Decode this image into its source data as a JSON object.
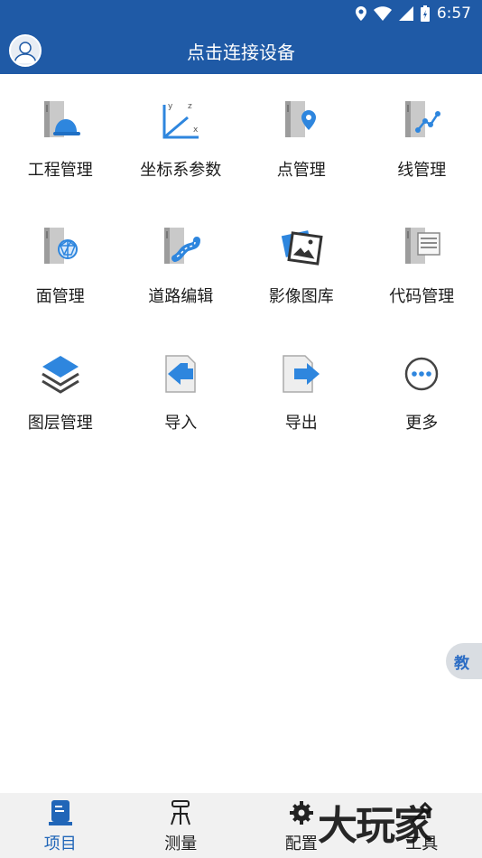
{
  "status_bar": {
    "time": "6:57",
    "bg_color": "#1f5aa6"
  },
  "header": {
    "title": "点击连接设备",
    "avatar_icon": "user-avatar-icon"
  },
  "grid": {
    "items": [
      {
        "label": "工程管理",
        "icon": "project-management-icon"
      },
      {
        "label": "坐标系参数",
        "icon": "coordinate-system-icon"
      },
      {
        "label": "点管理",
        "icon": "point-management-icon"
      },
      {
        "label": "线管理",
        "icon": "line-management-icon"
      },
      {
        "label": "面管理",
        "icon": "surface-management-icon"
      },
      {
        "label": "道路编辑",
        "icon": "road-edit-icon"
      },
      {
        "label": "影像图库",
        "icon": "image-library-icon"
      },
      {
        "label": "代码管理",
        "icon": "code-management-icon"
      },
      {
        "label": "图层管理",
        "icon": "layer-management-icon"
      },
      {
        "label": "导入",
        "icon": "import-icon"
      },
      {
        "label": "导出",
        "icon": "export-icon"
      },
      {
        "label": "更多",
        "icon": "more-icon"
      }
    ]
  },
  "side_tab": {
    "label": "教"
  },
  "bottom_nav": {
    "items": [
      {
        "label": "项目",
        "icon": "project-icon",
        "active": true
      },
      {
        "label": "测量",
        "icon": "survey-icon",
        "active": false
      },
      {
        "label": "配置",
        "icon": "gear-icon",
        "active": false
      },
      {
        "label": "工具",
        "icon": "tools-icon",
        "active": false
      }
    ]
  },
  "watermark": {
    "text": "大玩家"
  },
  "colors": {
    "accent": "#1f5aa6",
    "active_nav": "#2166b8"
  }
}
